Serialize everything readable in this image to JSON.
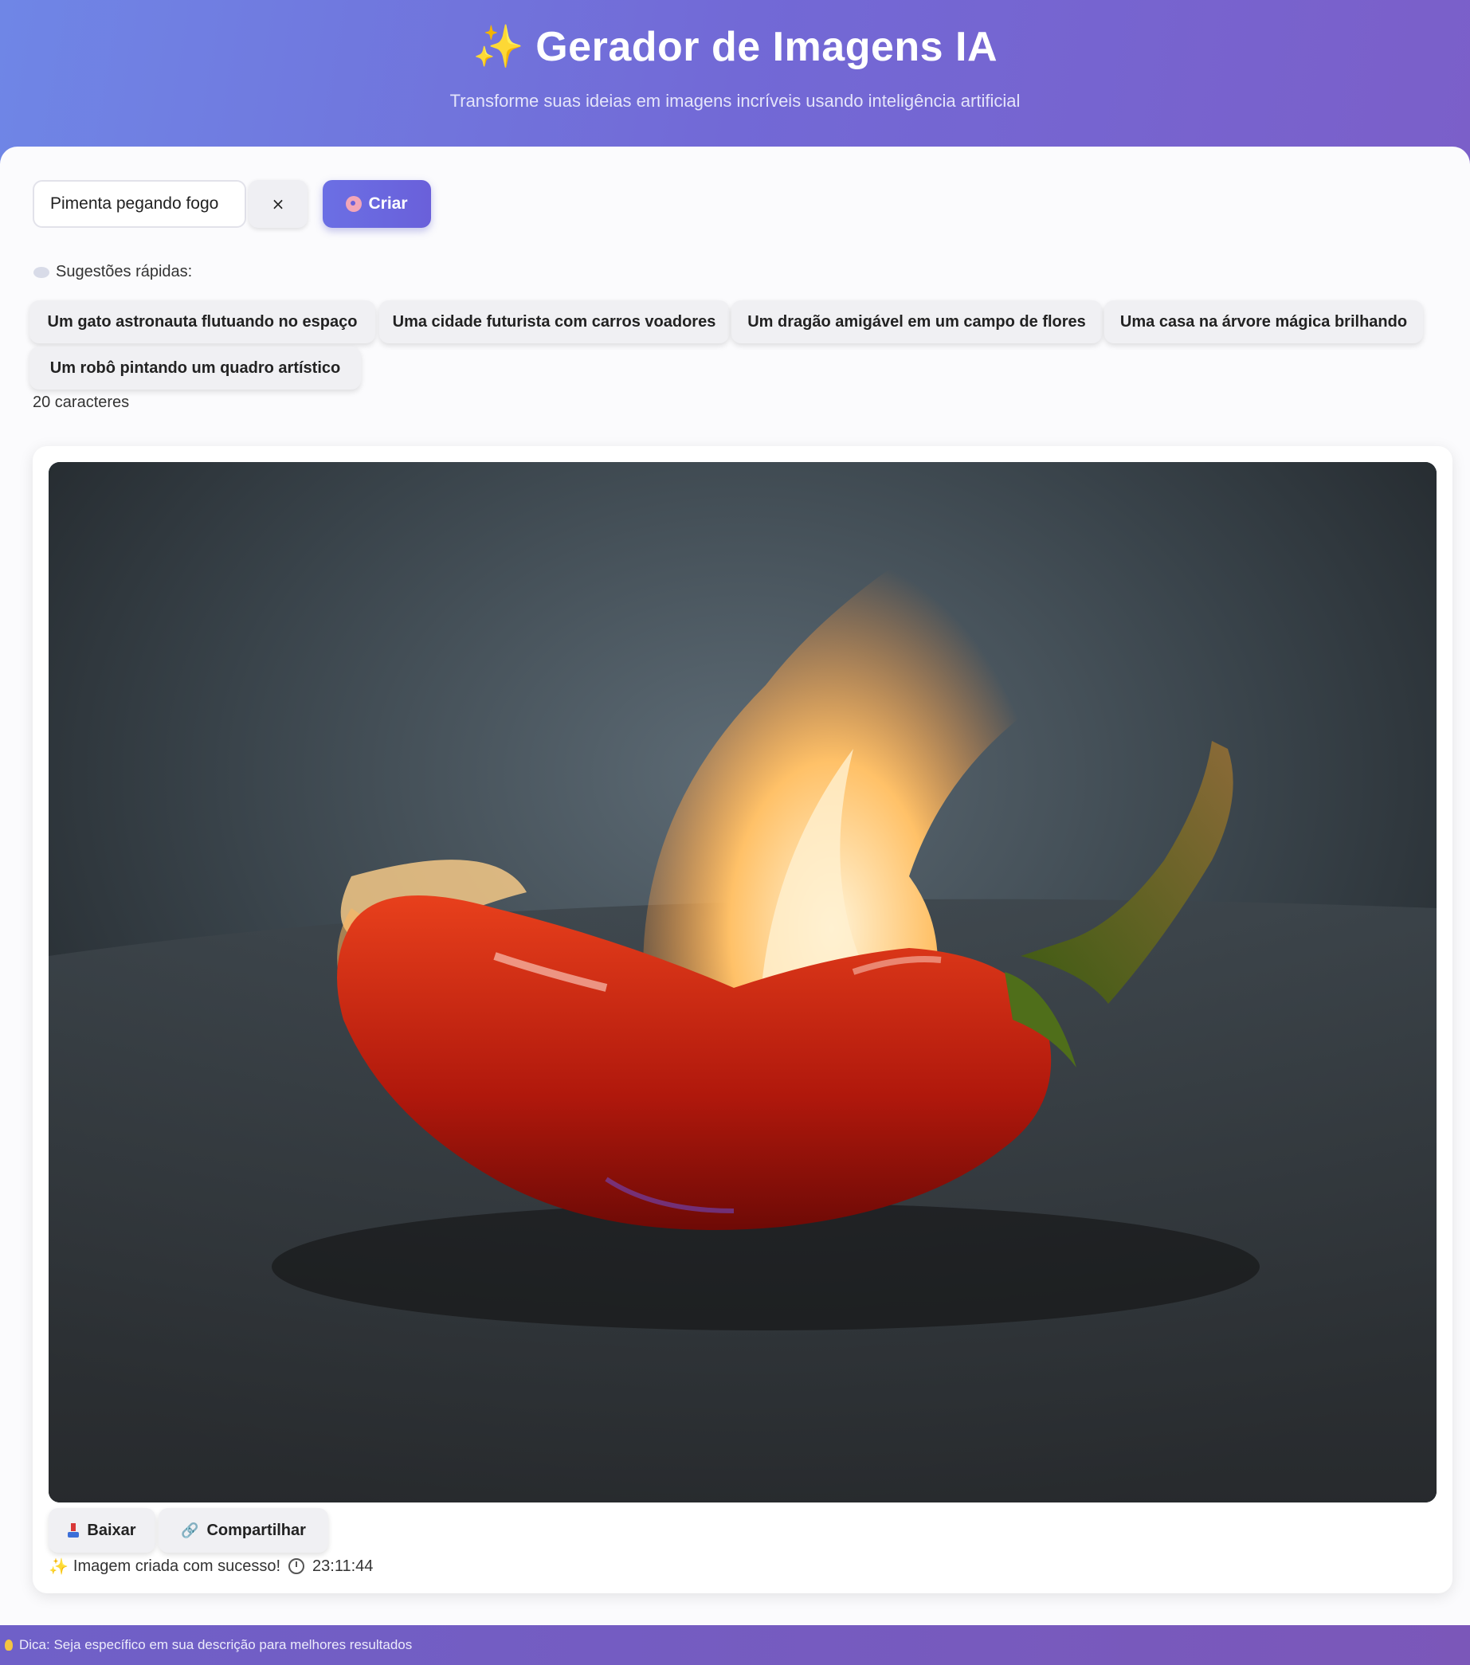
{
  "header": {
    "title": "Gerador de Imagens IA",
    "subtitle": "Transforme suas ideias em imagens incríveis usando inteligência artificial",
    "title_icon": "sparkles-icon"
  },
  "prompt": {
    "value": "Pimenta pegando fogo",
    "clear_label": "×",
    "create_label": "Criar"
  },
  "suggestions": {
    "label": "Sugestões rápidas:",
    "items": [
      "Um gato astronauta flutuando no espaço",
      "Uma cidade futurista com carros voadores",
      "Um dragão amigável em um campo de flores",
      "Uma casa na árvore mágica brilhando",
      "Um robô pintando um quadro artístico"
    ]
  },
  "char_count": "20 caracteres",
  "result": {
    "download_label": "Baixar",
    "share_label": "Compartilhar",
    "status_text": "Imagem criada com sucesso!",
    "time": "23:11:44"
  },
  "footer": {
    "tip": "Dica: Seja específico em sua descrição para melhores resultados"
  },
  "colors": {
    "accent": "#6a60da",
    "header_start": "#6f86e6",
    "header_end": "#7b5fc9"
  }
}
